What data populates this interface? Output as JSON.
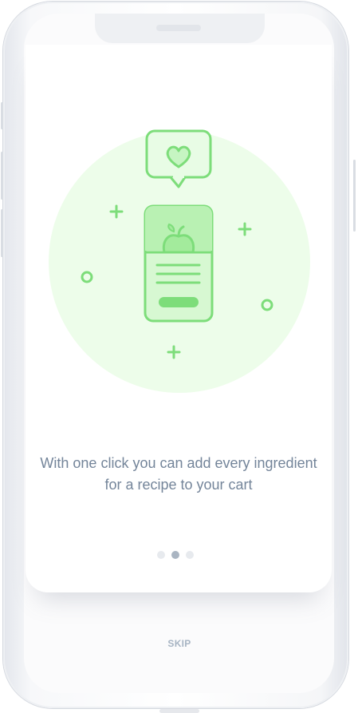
{
  "onboarding": {
    "caption": "With one click you can add every ingredient for a recipe to your cart",
    "pagination": {
      "total": 3,
      "current": 2
    },
    "skip_label": "SKIP"
  },
  "colors": {
    "accent": "#7ddd7a",
    "circle_bg": "#edfdea",
    "caption_text": "#74859a",
    "skip_text": "#a7b4c3"
  }
}
